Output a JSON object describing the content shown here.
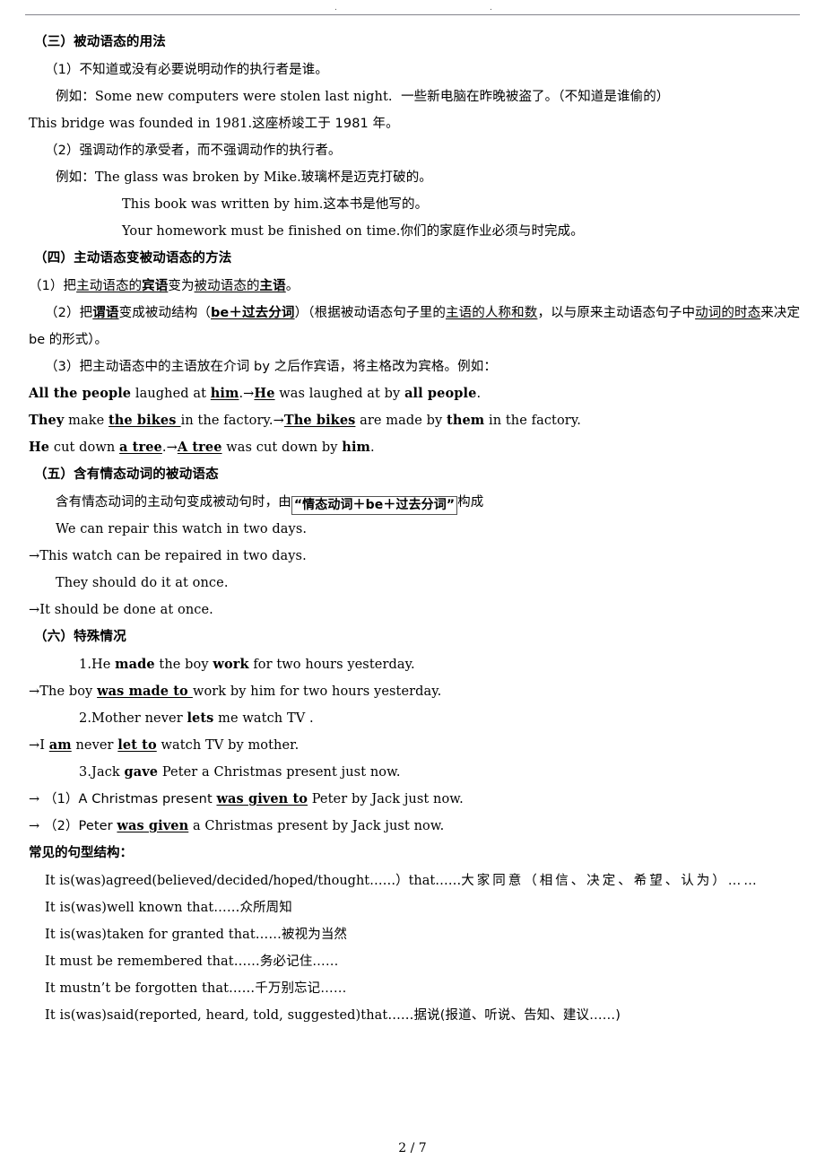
{
  "header": {
    "mark_left": ".",
    "mark_right": "."
  },
  "footer": {
    "page_number": "2 / 7"
  },
  "sections": {
    "s3_heading": "（三）被动语态的用法",
    "s3_p1": "（1）不知道或没有必要说明动作的执行者是谁。",
    "s3_ex1_label": "例如：",
    "s3_ex1_en": "Some new computers were stolen last night.",
    "s3_ex1_cn": "一些新电脑在昨晚被盗了。（不知道是谁偷的）",
    "s3_ex2_en": "This bridge was founded in 1981.",
    "s3_ex2_cn": "这座桥竣工于 1981 年。",
    "s3_p2": "（2）强调动作的承受者，而不强调动作的执行者。",
    "s3_ex3_label": "例如：",
    "s3_ex3_en": "The glass was broken by Mike.",
    "s3_ex3_cn": "玻璃杯是迈克打破的。",
    "s3_ex4_en": "This book was written by him.",
    "s3_ex4_cn": "这本书是他写的。",
    "s3_ex5_en": "Your homework must be finished on time.",
    "s3_ex5_cn": "你们的家庭作业必须与时完成。",
    "s4_heading": "（四）主动语态变被动语态的方法",
    "s4_r1_a": "（1）把",
    "s4_r1_u1": "主动语态的",
    "s4_r1_b1": "宾语",
    "s4_r1_b": "变为",
    "s4_r1_u2": "被动语态的",
    "s4_r1_b2": "主语",
    "s4_r1_c": "。",
    "s4_r2_a": "（2）把",
    "s4_r2_b1": "谓语",
    "s4_r2_b": "变成被动结构（",
    "s4_r2_b2": "be＋过去分词",
    "s4_r2_c": "）（根据被动语态句子里的",
    "s4_r2_u1": "主语的人称和数",
    "s4_r2_d": "，以与原来主动语态句子中",
    "s4_r2_u2": "动词的时态",
    "s4_r2_e": "来决定 be 的形式）。",
    "s4_r3": "（3）把主动语态中的主语放在介词 by 之后作宾语，将主格改为宾格。例如：",
    "ex_a_1": "All the people",
    "ex_a_2": " laughed at ",
    "ex_a_3": "him",
    "ex_a_4": ".",
    "ex_a_arrow": "→",
    "ex_a_5": "He",
    "ex_a_6": " was laughed at by ",
    "ex_a_7": "all people",
    "ex_a_8": ".",
    "ex_b_1": "They",
    "ex_b_2": " make ",
    "ex_b_3": "the bikes ",
    "ex_b_4": "in the factory.",
    "ex_b_arrow": "→",
    "ex_b_5": "The bikes",
    "ex_b_6": " are made by ",
    "ex_b_7": "them",
    "ex_b_8": " in the factory.",
    "ex_c_1": "He",
    "ex_c_2": " cut down ",
    "ex_c_3": "a tree",
    "ex_c_4": ".",
    "ex_c_arrow": "→",
    "ex_c_5": "A tree",
    "ex_c_6": " was cut down by ",
    "ex_c_7": "him",
    "ex_c_8": ".",
    "s5_heading": "（五）含有情态动词的被动语态",
    "s5_p1_a": "含有情态动词的主动句变成被动句时，由",
    "s5_p1_box": "“情态动词＋be＋过去分词”",
    "s5_p1_b": "构成",
    "s5_ex1": "We can repair this watch in two days.",
    "s5_ex1_arrow": "→",
    "s5_ex1_res": "This watch can be repaired in two days.",
    "s5_ex2": "They should do it at once.",
    "s5_ex2_arrow": "→",
    "s5_ex2_res": "It should be done at once.",
    "s6_heading": "（六）特殊情况",
    "s6_1_a": "1.He ",
    "s6_1_b1": "made",
    "s6_1_b": " the boy ",
    "s6_1_b2": "work",
    "s6_1_c": " for two hours yesterday.",
    "s6_1_arrow": "→",
    "s6_1_r_a": "The boy ",
    "s6_1_r_bu": "was made to ",
    "s6_1_r_b": "work by him for two hours yesterday.",
    "s6_2_a": "2.Mother never ",
    "s6_2_b1": "lets",
    "s6_2_b": " me watch TV .",
    "s6_2_arrow": "→",
    "s6_2_r_a": "I ",
    "s6_2_r_bu1": "am",
    "s6_2_r_b": " never ",
    "s6_2_r_bu2": "let to",
    "s6_2_r_c": " watch TV by mother.",
    "s6_3_a": "3.Jack ",
    "s6_3_b1": "gave",
    "s6_3_b": " Peter a Christmas present just now.",
    "s6_3_arrow": "→",
    "s6_3_r1_a": "（1）A Christmas present ",
    "s6_3_r1_bu": "was given to",
    "s6_3_r1_b": " Peter by Jack just now.",
    "s6_3_r2_arrow": "→",
    "s6_3_r2_a": "（2）Peter ",
    "s6_3_r2_bu": "was given",
    "s6_3_r2_b": " a Christmas present by Jack just now.",
    "patterns_heading": "常见的句型结构：",
    "pattern_1_en": "It is(was)agreed(believed/decided/hoped/thought……）that……",
    "pattern_1_cn": "大家同意（相信、决定、希望、认为）……",
    "pattern_2_en": "It is(was)well known that……",
    "pattern_2_cn": "众所周知",
    "pattern_3_en": "It is(was)taken for granted that……",
    "pattern_3_cn": "被视为当然",
    "pattern_4_en": "It must be remembered that……",
    "pattern_4_cn": "务必记住……",
    "pattern_5_en": "It mustn’t be forgotten that……",
    "pattern_5_cn": "千万别忘记……",
    "pattern_6_en": "It is(was)said(reported, heard, told, suggested)that……",
    "pattern_6_cn": "据说(报道、听说、告知、建议……)"
  }
}
